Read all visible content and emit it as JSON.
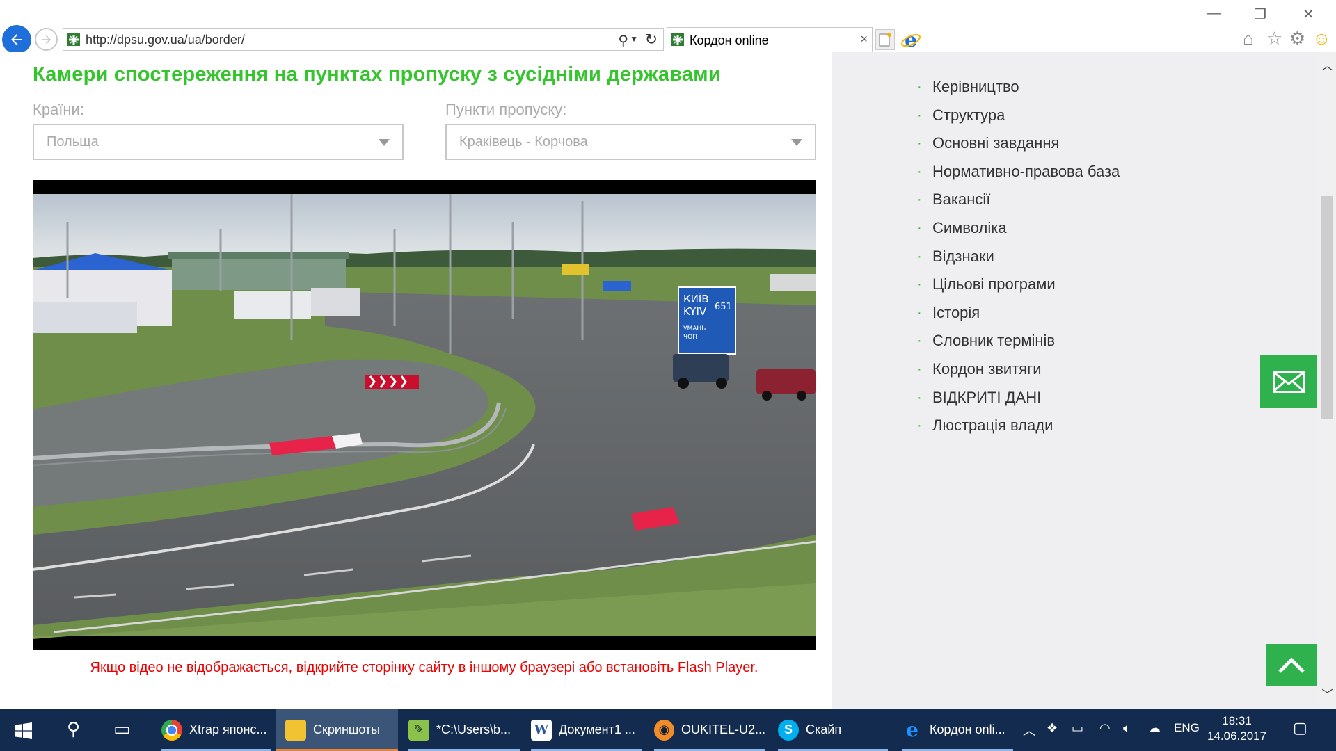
{
  "browser": {
    "url": "http://dpsu.gov.ua/ua/border/",
    "tab_title": "Кордон online",
    "tab_close": "×"
  },
  "page": {
    "title": "Камери спостереження на пунктах пропуску з сусідніми державами",
    "countries_label": "Країни:",
    "countries_value": "Польща",
    "checkpoints_label": "Пункти пропуску:",
    "checkpoints_value": "Краківець - Корчова",
    "notice": "Якщо відео не відображається, відкрийте сторінку сайту в іншому браузері або встановіть Flash Player.",
    "sign_top": "КИЇВ",
    "sign_bottom": "KYIV",
    "sign_km": "651",
    "sign_sub1": "УМАНЬ",
    "sign_sub2": "ЧОП"
  },
  "sidebar": {
    "menu": [
      "Керівництво",
      "Структура",
      "Основні завдання",
      "Нормативно-правова база",
      "Вакансії",
      "Символіка",
      "Відзнаки",
      "Цільові програми",
      "Історія",
      "Словник термінів",
      "Кордон звитяги",
      "ВІДКРИТІ ДАНІ",
      "Люстрація влади"
    ],
    "bullet": "·"
  },
  "taskbar": {
    "items": [
      {
        "label": "Xtrap японс...",
        "icon": "chrome-icon"
      },
      {
        "label": "Скриншоты",
        "icon": "folder-icon"
      },
      {
        "label": "*C:\\Users\\b...",
        "icon": "notepad-icon"
      },
      {
        "label": "Документ1 ...",
        "icon": "word-icon"
      },
      {
        "label": "OUKITEL-U2...",
        "icon": "app-icon"
      },
      {
        "label": "Скайп",
        "icon": "skype-icon"
      },
      {
        "label": "Кордон onli...",
        "icon": "ie-icon"
      }
    ],
    "lang": "ENG",
    "time": "18:31",
    "date": "14.06.2017"
  },
  "colors": {
    "accent_green": "#34c42b",
    "button_green": "#2fb14e",
    "notice_red": "#e00000",
    "taskbar": "#122b4e"
  }
}
